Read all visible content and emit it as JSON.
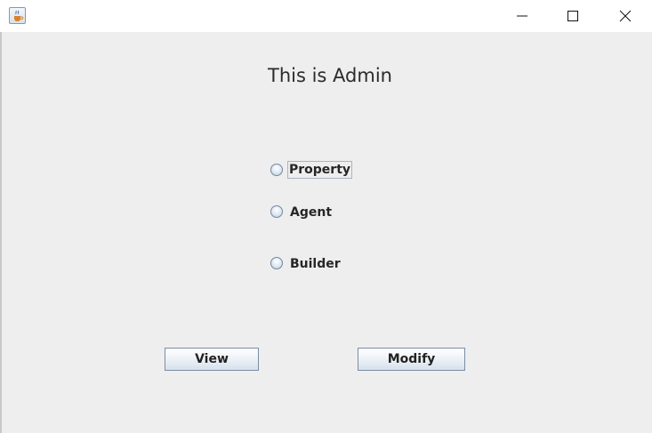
{
  "window": {
    "app_icon": "java-cup-icon",
    "controls": {
      "minimize_icon": "minimize-icon",
      "maximize_icon": "maximize-icon",
      "close_icon": "close-icon"
    }
  },
  "main": {
    "title": "This is Admin",
    "options": [
      {
        "label": "Property",
        "checked": false,
        "focused": true
      },
      {
        "label": "Agent",
        "checked": false,
        "focused": false
      },
      {
        "label": "Builder",
        "checked": false,
        "focused": false
      }
    ],
    "buttons": {
      "view_label": "View",
      "modify_label": "Modify"
    }
  }
}
